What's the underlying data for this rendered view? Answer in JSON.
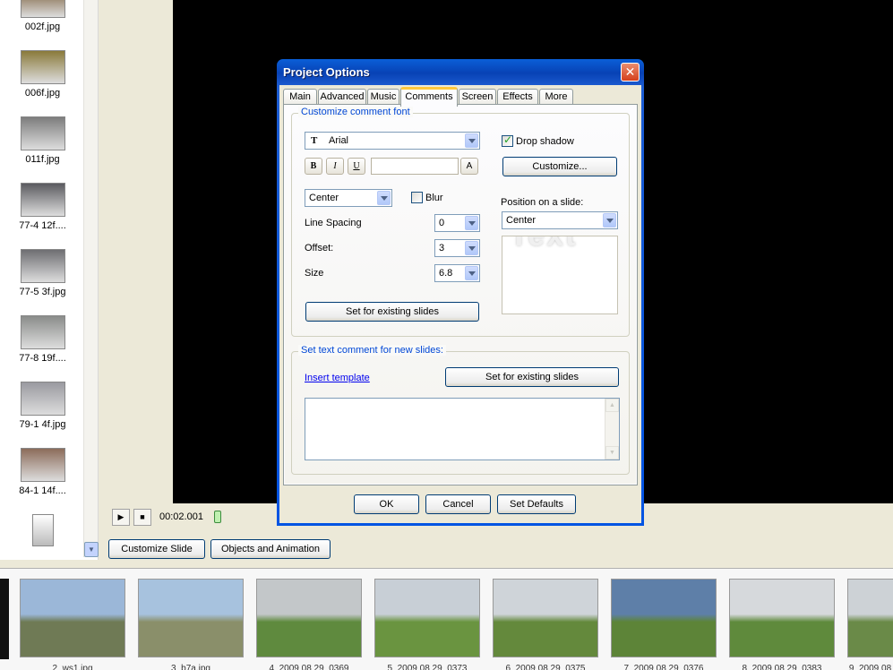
{
  "file_list": [
    {
      "name": "002f.jpg",
      "thumb": "#6b4b22"
    },
    {
      "name": "006f.jpg",
      "thumb": "#8a7a3a"
    },
    {
      "name": "011f.jpg",
      "thumb": "#7d7d7d"
    },
    {
      "name": "77-4 12f....",
      "thumb": "#5b5b60"
    },
    {
      "name": "77-5 3f.jpg",
      "thumb": "#6e6e72"
    },
    {
      "name": "77-8 19f....",
      "thumb": "#8a8c8a"
    },
    {
      "name": "79-1 4f.jpg",
      "thumb": "#9a9aa0"
    },
    {
      "name": "84-1 14f....",
      "thumb": "#8c6c5a"
    }
  ],
  "player": {
    "play_icon": "play-icon",
    "stop_icon": "stop-icon",
    "time": "00:02.001"
  },
  "slide_buttons": {
    "customize": "Customize Slide",
    "objects": "Objects and Animation"
  },
  "filmstrip": [
    {
      "label": "2_ws1.jpg",
      "sky": "#9bb7d8",
      "ground": "#6f7a55"
    },
    {
      "label": "3_b7a.jpg",
      "sky": "#a7c2de",
      "ground": "#8a8f6a"
    },
    {
      "label": "4_2009 08 29_0369",
      "sky": "#c3c7c9",
      "ground": "#5f8a3e"
    },
    {
      "label": "5_2009 08 29_0373",
      "sky": "#c8cfd6",
      "ground": "#6a9440"
    },
    {
      "label": "6_2009 08 29_0375",
      "sky": "#cfd4d9",
      "ground": "#64893c"
    },
    {
      "label": "7_2009 08 29_0376",
      "sky": "#5e7fa8",
      "ground": "#5d8438"
    },
    {
      "label": "8_2009 08 29_0383",
      "sky": "#d6d9dc",
      "ground": "#5f8a3c"
    },
    {
      "label": "9_2009 08",
      "sky": "#cdd2d6",
      "ground": "#6a8a48"
    }
  ],
  "dialog": {
    "title": "Project Options",
    "close": "✕",
    "tabs": [
      "Main",
      "Advanced",
      "Music",
      "Comments",
      "Screen",
      "Effects",
      "More"
    ],
    "active_tab": "Comments",
    "font_group": {
      "legend": "Customize comment font",
      "font_name": "Arial",
      "bold": "B",
      "italic": "I",
      "underline": "U",
      "color_button": "A",
      "align": "Center",
      "blur_label": "Blur",
      "blur_checked": false,
      "drop_shadow_label": "Drop shadow",
      "drop_shadow_checked": true,
      "customize_button": "Customize...",
      "line_spacing_label": "Line Spacing",
      "line_spacing": "0",
      "offset_label": "Offset:",
      "offset": "3",
      "size_label": "Size",
      "size": "6.8",
      "position_label": "Position on a slide:",
      "position": "Center",
      "set_existing_button": "Set for existing slides",
      "preview_word": "Text"
    },
    "new_slides_group": {
      "legend": "Set text comment for new slides:",
      "insert_template": "Insert template",
      "set_existing_button": "Set for existing slides",
      "comment_text": ""
    },
    "buttons": {
      "ok": "OK",
      "cancel": "Cancel",
      "defaults": "Set Defaults"
    }
  }
}
